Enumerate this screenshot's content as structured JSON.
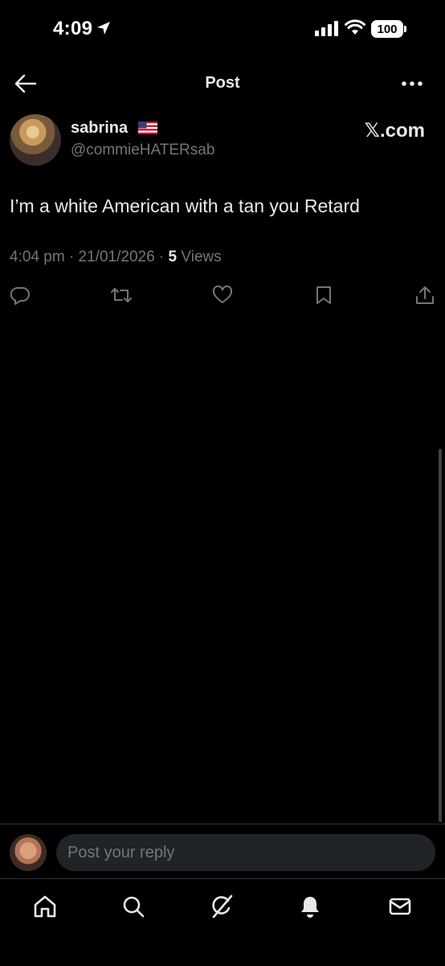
{
  "status_bar": {
    "time": "4:09",
    "battery": "100"
  },
  "nav": {
    "title": "Post",
    "back_icon": "arrow-left-icon",
    "more_icon": "more-dots-icon"
  },
  "post": {
    "display_name": "sabrina",
    "flag_icon": "us-flag-icon",
    "handle": "@commieHATERsab",
    "brand": "𝕏.com",
    "text": "I’m a white American with a tan you Retard",
    "time": "4:04 pm",
    "date": "21/01/2026",
    "views_count": "5",
    "views_label": "Views",
    "separator": "·"
  },
  "actions": [
    "reply-icon",
    "repost-icon",
    "like-icon",
    "bookmark-icon",
    "share-icon"
  ],
  "reply": {
    "placeholder": "Post your reply"
  },
  "tabs": [
    "home-icon",
    "search-icon",
    "grok-icon",
    "notifications-icon",
    "messages-icon"
  ],
  "colors": {
    "background": "#000000",
    "text": "#e7e9ea",
    "muted": "#71767b",
    "input_bg": "#202327"
  }
}
